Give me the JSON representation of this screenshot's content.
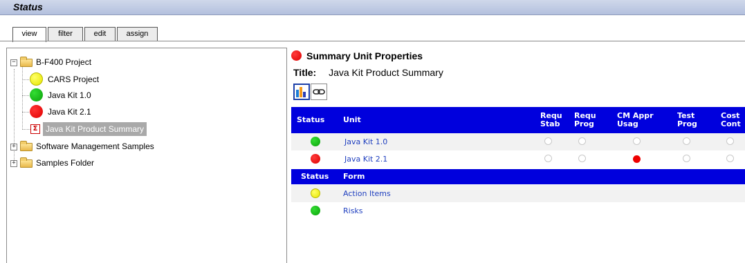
{
  "header": {
    "title": "Status"
  },
  "tabs": [
    {
      "label": "view",
      "active": true
    },
    {
      "label": "filter",
      "active": false
    },
    {
      "label": "edit",
      "active": false
    },
    {
      "label": "assign",
      "active": false
    }
  ],
  "tree": {
    "root": {
      "label": "B-F400 Project",
      "expanded": true
    },
    "children": [
      {
        "label": "CARS Project",
        "status": "yellow"
      },
      {
        "label": "Java Kit 1.0",
        "status": "green"
      },
      {
        "label": "Java Kit 2.1",
        "status": "red"
      },
      {
        "label": "Java Kit Product Summary",
        "icon": "sigma-icon",
        "selected": true
      }
    ],
    "folders": [
      {
        "label": "Software Management Samples",
        "expanded": false
      },
      {
        "label": "Samples Folder",
        "expanded": false
      }
    ]
  },
  "summary": {
    "heading": "Summary Unit Properties",
    "heading_status": "red",
    "title_label": "Title:",
    "title_value": "Java Kit Product Summary",
    "tool_icons": [
      "bar-chart-icon",
      "link-icon"
    ]
  },
  "unit_table": {
    "columns": [
      "Status",
      "Unit",
      "Requ\nStab",
      "Requ\nProg",
      "CM Appr\nUsag",
      "Test\nProg",
      "Cost\nCont"
    ],
    "column_lines": [
      [
        "Status"
      ],
      [
        "Unit"
      ],
      [
        "Requ",
        "Stab"
      ],
      [
        "Requ",
        "Prog"
      ],
      [
        "CM Appr",
        "Usag"
      ],
      [
        "Test",
        "Prog"
      ],
      [
        "Cost",
        "Cont"
      ]
    ],
    "rows": [
      {
        "status": "green",
        "unit": "Java Kit 1.0",
        "metrics": [
          "empty",
          "empty",
          "empty",
          "empty",
          "empty"
        ]
      },
      {
        "status": "red",
        "unit": "Java Kit 2.1",
        "metrics": [
          "empty",
          "empty",
          "red",
          "empty",
          "empty"
        ]
      }
    ]
  },
  "form_table": {
    "columns": [
      "Status",
      "Form"
    ],
    "rows": [
      {
        "status": "yellow",
        "form": "Action Items"
      },
      {
        "status": "green",
        "form": "Risks"
      }
    ]
  },
  "colors": {
    "table_header_bg": "#0000dd",
    "link": "#1f3fbf",
    "green": "#0aa00a",
    "yellow": "#ffff33",
    "red": "#ee0000"
  }
}
